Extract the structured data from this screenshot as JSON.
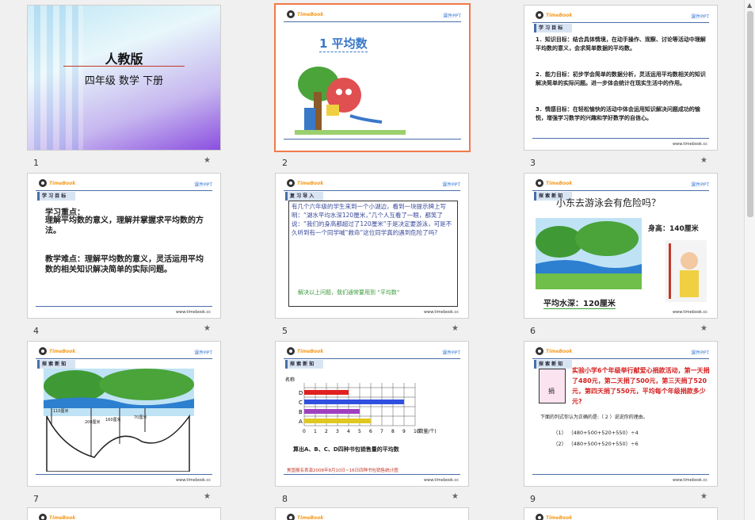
{
  "slides": [
    {
      "num": "1",
      "title": "人教版",
      "subtitle": "四年级  数学  下册"
    },
    {
      "num": "2",
      "title": "1  平均数"
    },
    {
      "num": "3",
      "tag": "学 习 目 标",
      "p1": "1．知识目标：结合具体情境，在动手操作、观察、讨论等活动中理解平均数的意义，会求简单数据的平均数。",
      "p2": "2．能力目标：初步学会简单的数据分析，灵活运用平均数相关的知识解决简单的实际问题。进一步体会统计在现实生活中的作用。",
      "p3": "3．情感目标：在轻松愉快的活动中体会运用知识解决问题成功的愉悦，增强学习数学的兴趣和学好数学的自信心。"
    },
    {
      "num": "4",
      "tag": "学 习 目 标",
      "p1": "学习重点：",
      "p1b": "理解平均数的意义，理解并掌握求平均数的方法。",
      "p2": "教学难点：理解平均数的意义，灵活运用平均数的相关知识解决简单的实际问题。"
    },
    {
      "num": "5",
      "tag": "复 习 导 入",
      "body": "有几个六年级的学生来到一个小湖边，看到一块提示牌上写明：“湖水平均水深120厘米，”几个人互看了一眼，都笑了说：“我们的身高都超过了120厘米“于是决定要游泳，可是不久听到有一个同学喊“救命“这位同学真的遇到危险了吗?",
      "footer": "解决以上问题，我们通常要用到  “平均数“"
    },
    {
      "num": "6",
      "tag": "探 索 新 知",
      "q": "小东去游泳会有危险吗？",
      "height": "身高：140厘米",
      "depth": "平均水深：120厘米"
    },
    {
      "num": "7",
      "tag": "探 索 新 知",
      "l1": "110厘米",
      "l2": "200厘米",
      "l3": "160厘米",
      "l4": "70厘米"
    },
    {
      "num": "8",
      "tag": "探 索 新 知",
      "ylabel": "名称",
      "xlabel": "(数量/个)",
      "caption": "算出A、B、C、D四种书包销售量的平均数",
      "source": "美国报名表演2008年8月10日~16日四种书包销售统计图"
    },
    {
      "num": "9",
      "tag": "探 索 新 知",
      "box": "捐",
      "red": "实验小学6个年级举行献爱心捐款活动，第一天捐了480元，第二天捐了500元，第三天捐了520元，第四天捐了550元，平均每个年级捐款多少元?",
      "ask": "下面的列式你认为正确的是:（    2  ）说说你的理由。",
      "o1": "（1）  （480+500+520+550）÷4",
      "o2": "（2）  （480+500+520+550）÷6"
    }
  ],
  "common": {
    "logo": "TimeBook",
    "kejian": "课件PPT",
    "url": "www.timebook.cc"
  },
  "chart_data": {
    "type": "bar",
    "categories": [
      "A",
      "B",
      "C",
      "D"
    ],
    "values": [
      6,
      5,
      9,
      4
    ],
    "ylabel": "名称",
    "xlabel": "(数量/个)",
    "xticks": [
      "0",
      "1",
      "2",
      "3",
      "4",
      "5",
      "6",
      "7",
      "8",
      "9",
      "10"
    ],
    "xlim": [
      0,
      10
    ],
    "colors": [
      "#e0c820",
      "#a040c0",
      "#3050e0",
      "#e02020"
    ]
  }
}
